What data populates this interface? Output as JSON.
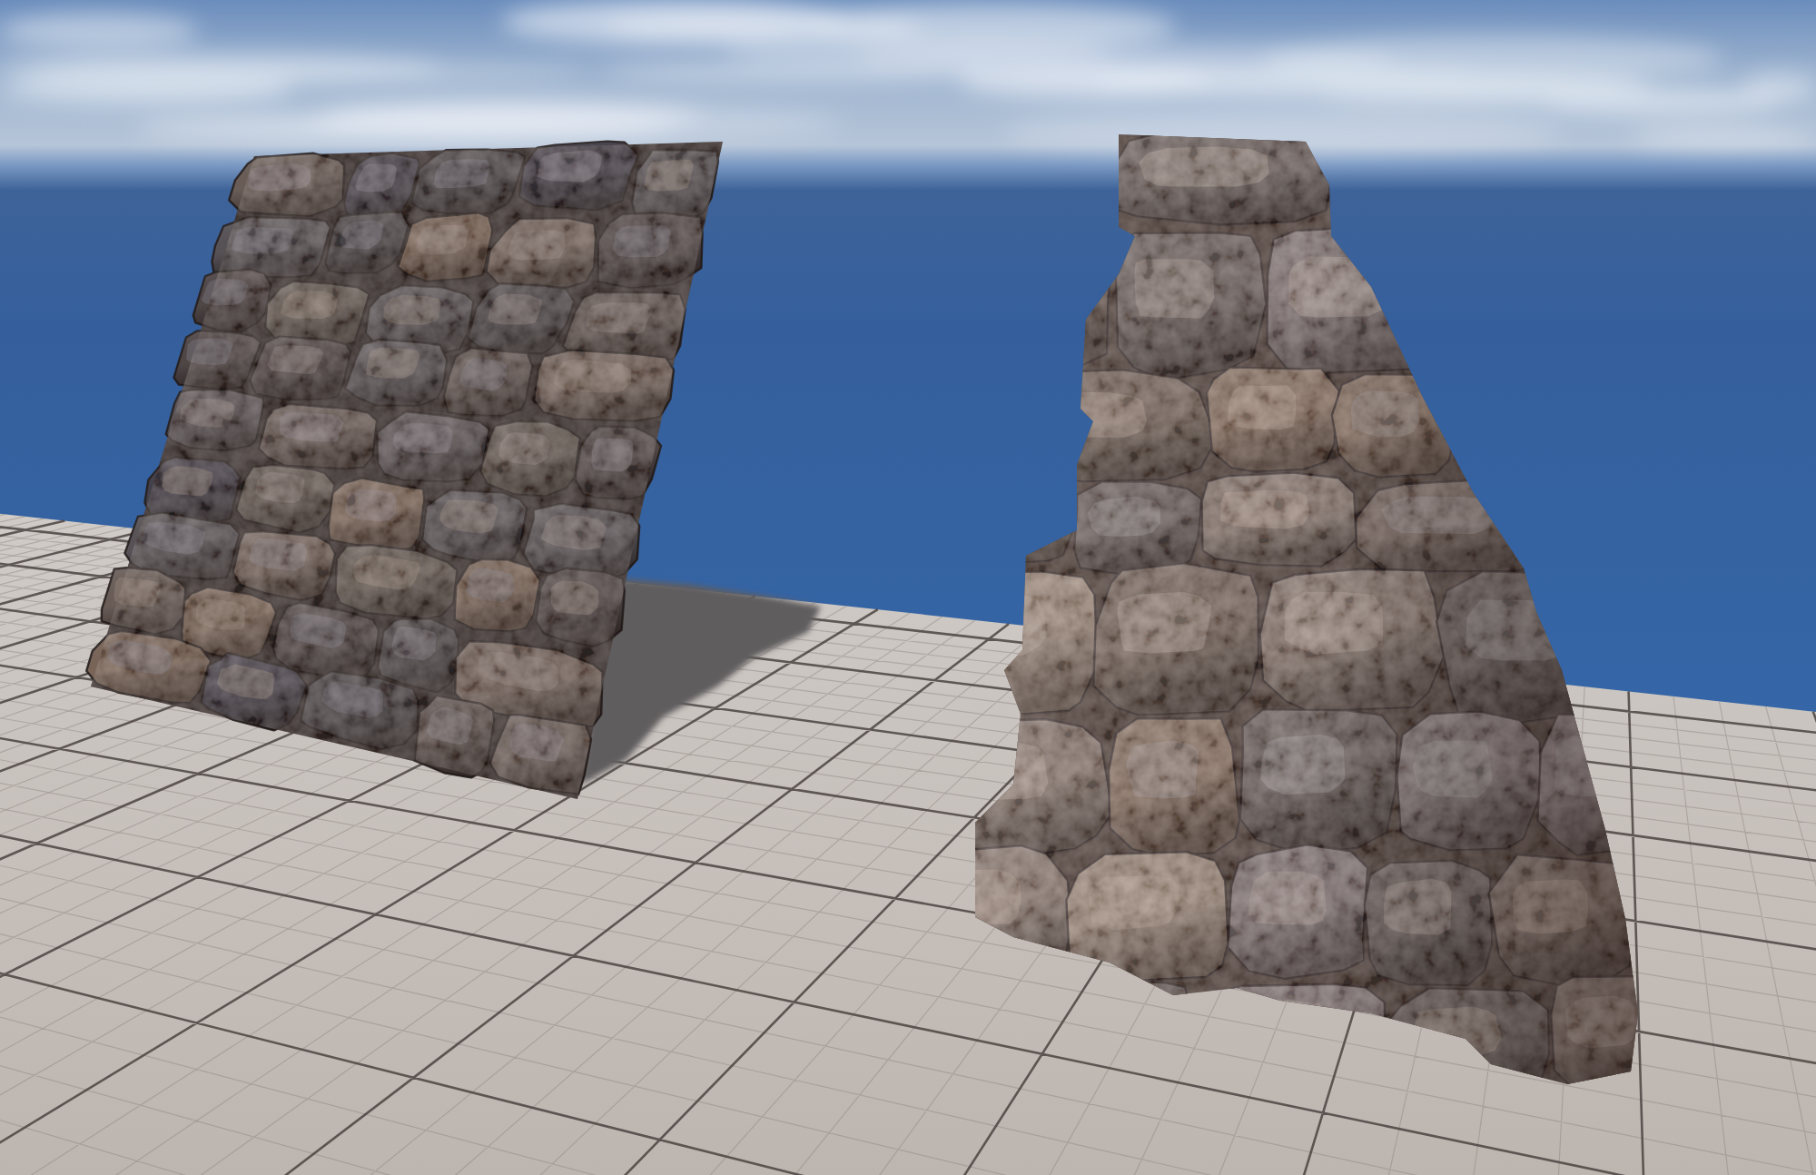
{
  "scene": {
    "items": [
      {
        "kind": "sky"
      },
      {
        "kind": "floor"
      },
      {
        "kind": "wall"
      },
      {
        "kind": "pyramid"
      }
    ]
  }
}
